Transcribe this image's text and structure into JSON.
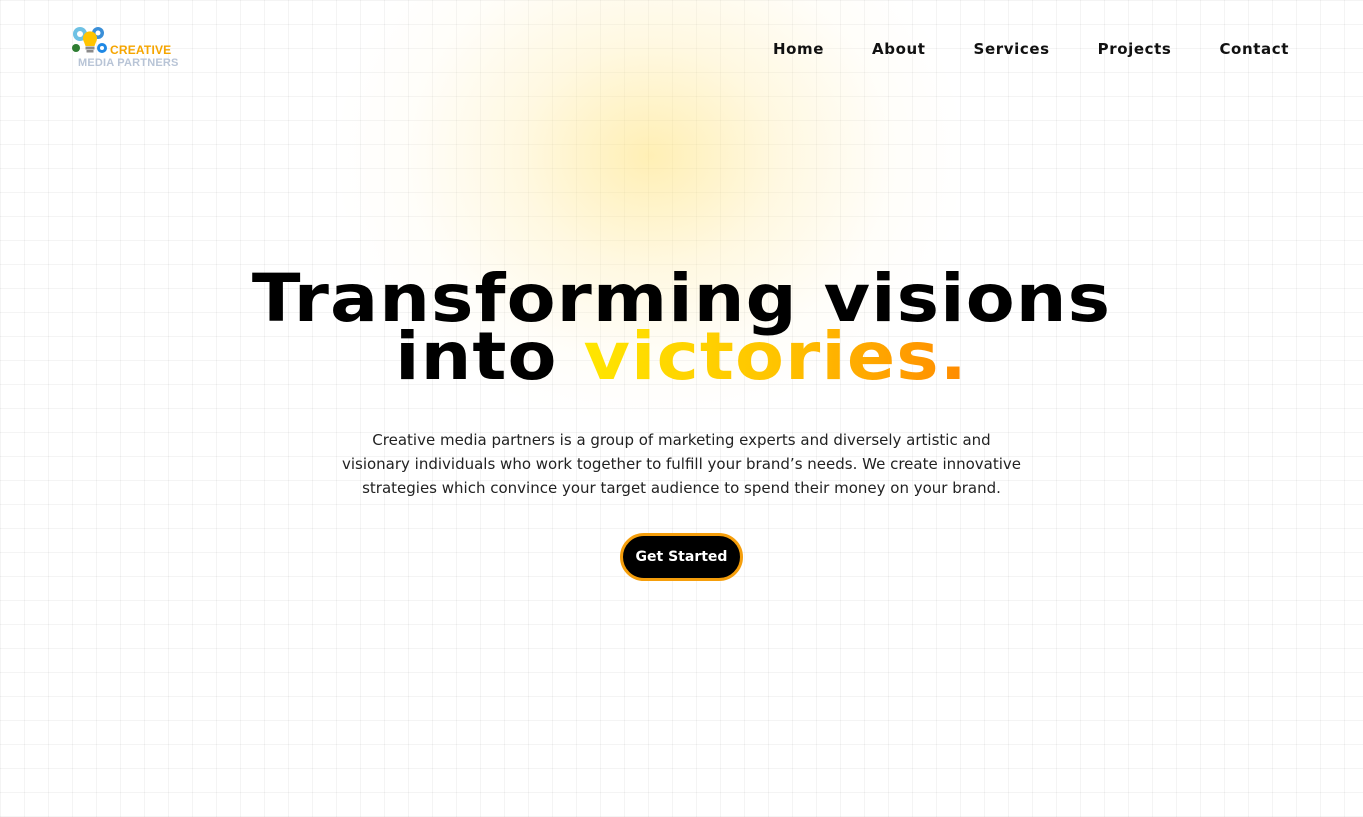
{
  "header": {
    "logo": {
      "line1": "CREATIVE",
      "line2": "MEDIA PARTNERS",
      "icon": "lightbulb-gears-icon"
    },
    "nav": [
      {
        "label": "Home"
      },
      {
        "label": "About"
      },
      {
        "label": "Services"
      },
      {
        "label": "Projects"
      },
      {
        "label": "Contact"
      }
    ]
  },
  "hero": {
    "headline_line1": "Transforming visions",
    "headline_line2_plain": "into ",
    "headline_line2_accent": "victories.",
    "description": "Creative media partners is a group of marketing experts and diversely artistic and visionary individuals who work together to fulfill your brand’s needs. We create innovative strategies which convince your target audience to spend their money on your brand.",
    "cta_label": "Get Started"
  },
  "colors": {
    "accent_start": "#ffe600",
    "accent_end": "#ff8a00",
    "cta_border": "#f59e0b",
    "cta_bg": "#000000"
  }
}
